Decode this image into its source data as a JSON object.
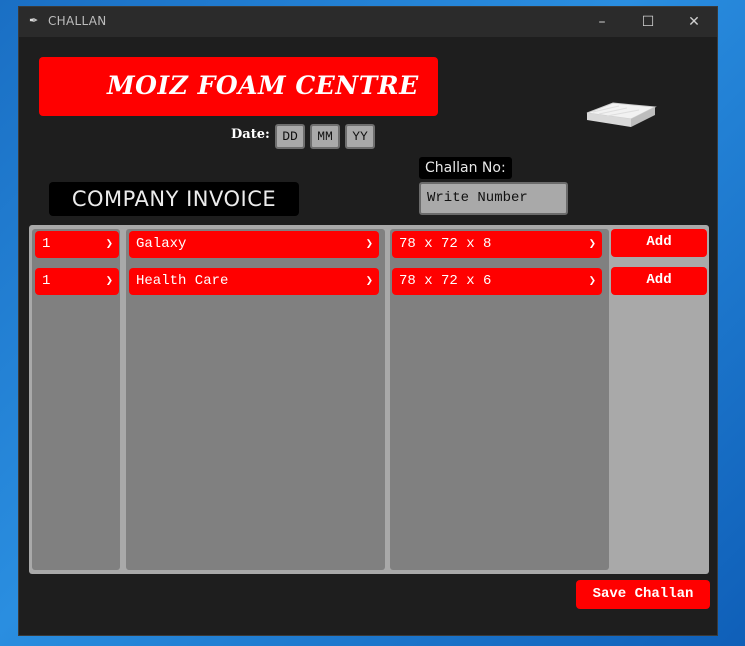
{
  "window": {
    "title": "CHALLAN"
  },
  "header": {
    "company_name": "MOIZ FOAM CENTRE"
  },
  "date": {
    "label": "Date:",
    "day_placeholder": "DD",
    "month_placeholder": "MM",
    "year_placeholder": "YY"
  },
  "challan": {
    "label": "Challan No:",
    "placeholder": "Write Number"
  },
  "invoice_label": "COMPANY INVOICE",
  "rows": [
    {
      "qty": "1",
      "product": "Galaxy",
      "size": "78 x 72 x 8",
      "add_label": "Add"
    },
    {
      "qty": "1",
      "product": "Health Care",
      "size": "78 x 72 x 6",
      "add_label": "Add"
    }
  ],
  "save_label": "Save Challan",
  "icons": {
    "app": "pen-icon",
    "minimize": "minimize-icon",
    "maximize": "maximize-icon",
    "close": "close-icon",
    "dropdown": "chevron-down-icon",
    "product_image": "mattress-image"
  },
  "colors": {
    "accent": "#ff0000",
    "window_bg": "#1e1e1e",
    "panel": "#808080",
    "panel_border": "#a9a9a9"
  }
}
